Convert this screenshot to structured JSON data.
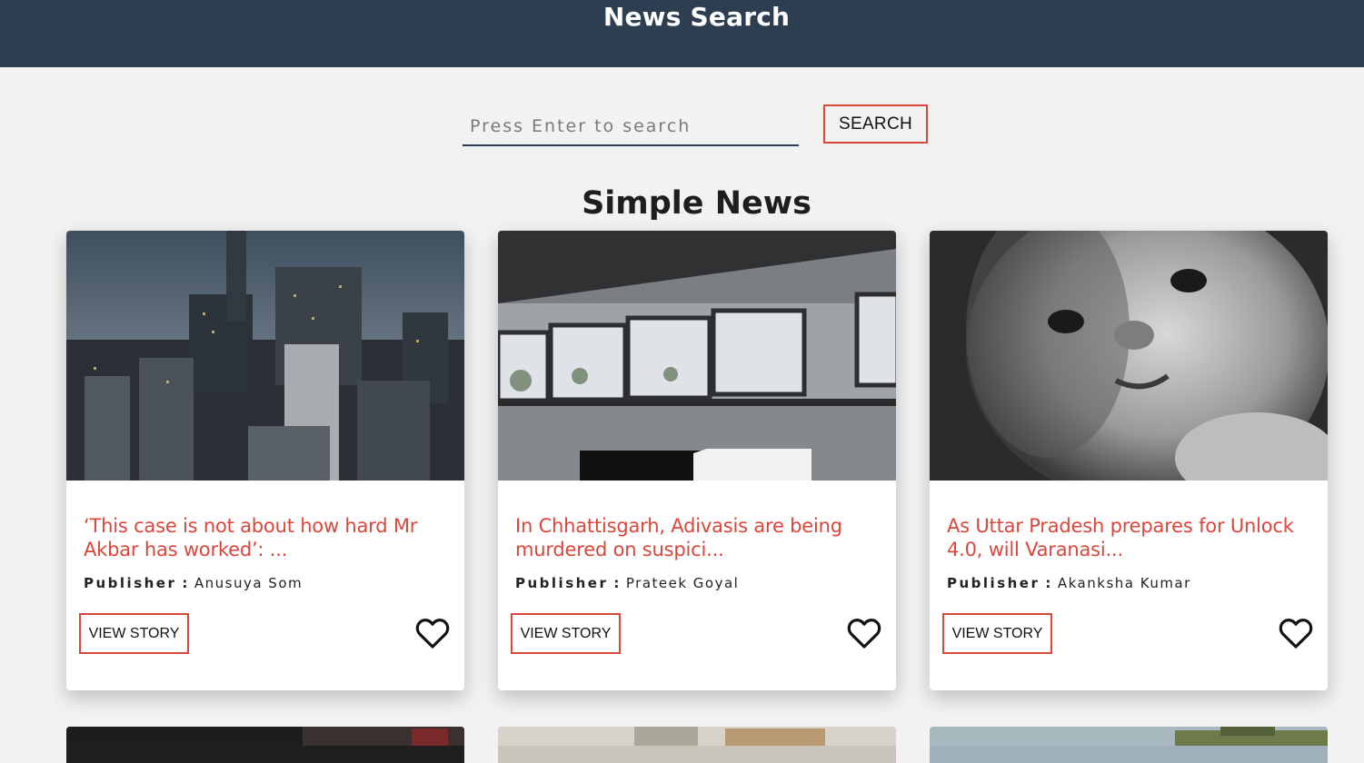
{
  "header": {
    "title": "News Search"
  },
  "search": {
    "placeholder": "Press Enter to search",
    "button_label": "SEARCH"
  },
  "section": {
    "title": "Simple News"
  },
  "colors": {
    "header_bg": "#2d3e50",
    "accent": "#d9463b",
    "page_bg": "#f2f2f2"
  },
  "cards": [
    {
      "headline": "‘This case is not about how hard Mr Akbar has worked’: ...",
      "publisher_label": "Publisher",
      "publisher_name": "Anusuya Som",
      "button_label": "VIEW STORY",
      "icon": "heart-outline-icon",
      "image": "city-skyline-photo"
    },
    {
      "headline": "In Chhattisgarh, Adivasis are being murdered on suspici...",
      "publisher_label": "Publisher",
      "publisher_name": "Prateek Goyal",
      "button_label": "VIEW STORY",
      "icon": "heart-outline-icon",
      "image": "building-windows-photo"
    },
    {
      "headline": "As Uttar Pradesh prepares for Unlock 4.0, will Varanasi...",
      "publisher_label": "Publisher",
      "publisher_name": "Akanksha Kumar",
      "button_label": "VIEW STORY",
      "icon": "heart-outline-icon",
      "image": "baby-portrait-photo"
    }
  ]
}
